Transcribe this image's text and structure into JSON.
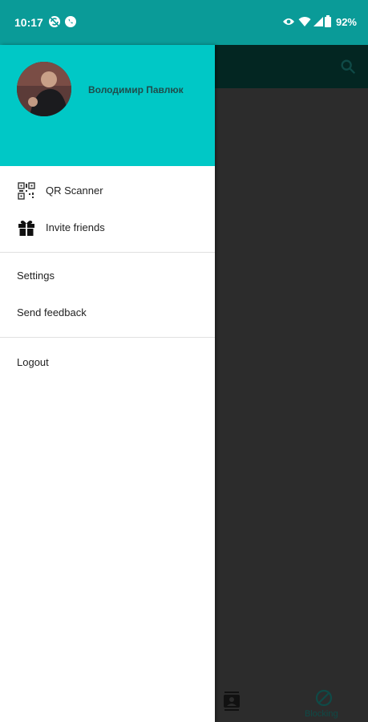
{
  "status_bar": {
    "time": "10:17",
    "battery": "92%",
    "left_icons": [
      "sync-disabled-icon",
      "whatsapp-icon"
    ],
    "right_icons": [
      "eye-icon",
      "wifi-icon",
      "signal-icon",
      "battery-icon"
    ]
  },
  "drawer": {
    "user_name": "Володимир Павлюк",
    "primary_items": [
      {
        "label": "QR Scanner",
        "icon": "qr-code-icon"
      },
      {
        "label": "Invite friends",
        "icon": "gift-icon"
      }
    ],
    "secondary_items": [
      {
        "label": "Settings"
      },
      {
        "label": "Send feedback"
      }
    ],
    "logout_label": "Logout"
  },
  "background_app": {
    "bottom_nav_label": "Blocking",
    "icons": [
      "search-icon",
      "contacts-icon",
      "block-icon"
    ]
  },
  "colors": {
    "status_bar": "#0a9b98",
    "drawer_header": "#00c8c6",
    "scrim": "#2c2c2c"
  }
}
